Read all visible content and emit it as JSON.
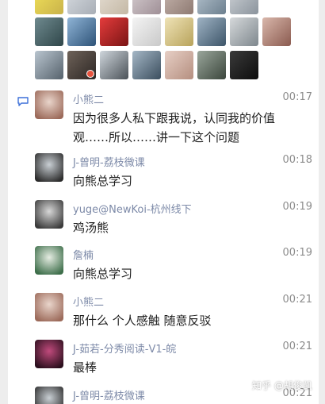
{
  "members_grid": {
    "avatars": [
      {
        "icon": "member-avatar",
        "colors": [
          "#f2e35a",
          "#c9b24a"
        ]
      },
      {
        "icon": "member-avatar",
        "colors": [
          "#d9dde2",
          "#a8aeb6"
        ]
      },
      {
        "icon": "member-avatar",
        "colors": [
          "#e6dfd5",
          "#c4b8a5"
        ]
      },
      {
        "icon": "member-avatar",
        "colors": [
          "#d8d0d3",
          "#9f8f96"
        ]
      },
      {
        "icon": "member-avatar",
        "colors": [
          "#c8b7b0",
          "#8e7a72"
        ]
      },
      {
        "icon": "member-avatar",
        "colors": [
          "#b9c7d2",
          "#6c7f8e"
        ]
      },
      {
        "icon": "member-avatar",
        "colors": [
          "#d0d4d8",
          "#8a939c"
        ]
      },
      {
        "icon": "member-avatar",
        "colors": [
          "#6f8a8f",
          "#2f4649"
        ]
      },
      {
        "icon": "member-avatar",
        "colors": [
          "#8fb4d6",
          "#2e5378"
        ]
      },
      {
        "icon": "member-avatar",
        "colors": [
          "#e53c3c",
          "#7a1414"
        ]
      },
      {
        "icon": "member-avatar",
        "colors": [
          "#f4f4f4",
          "#c9c9c9"
        ]
      },
      {
        "icon": "member-avatar",
        "colors": [
          "#efe3b7",
          "#b8a35b"
        ]
      },
      {
        "icon": "member-avatar",
        "colors": [
          "#9fb3c4",
          "#3d5569"
        ]
      },
      {
        "icon": "member-avatar",
        "colors": [
          "#d6d9db",
          "#7e878d"
        ]
      },
      {
        "icon": "member-avatar",
        "colors": [
          "#d9b7ab",
          "#8a5a4f"
        ]
      },
      {
        "icon": "member-avatar",
        "colors": [
          "#b9c5cf",
          "#56626c"
        ]
      },
      {
        "icon": "member-avatar",
        "colors": [
          "#6e6259",
          "#2d2724"
        ],
        "badge": true
      },
      {
        "icon": "member-avatar",
        "colors": [
          "#cfd6dc",
          "#4b5258"
        ]
      },
      {
        "icon": "member-avatar",
        "colors": [
          "#a5b7c6",
          "#3b4e5e"
        ]
      },
      {
        "icon": "member-avatar",
        "colors": [
          "#e7cfc5",
          "#b58f80"
        ]
      },
      {
        "icon": "member-avatar",
        "colors": [
          "#9aa69b",
          "#3b463c"
        ]
      },
      {
        "icon": "member-avatar",
        "colors": [
          "#3a3a3a",
          "#0d0d0d"
        ]
      }
    ]
  },
  "messages": [
    {
      "name": "小熊二",
      "time": "00:17",
      "text": "因为很多人私下跟我说，认同我的价值观……所以……讲一下这个问题",
      "avatar_colors": [
        "#e9d5cb",
        "#9c6a5a"
      ],
      "name_color": "#7d8aa8"
    },
    {
      "name": "J-曾明-荔枝微课",
      "time": "00:18",
      "text": "向熊总学习",
      "avatar_colors": [
        "#c9cfd4",
        "#2c2c2c"
      ],
      "name_color": "#7d8aa8"
    },
    {
      "name": "yuge@NewKoi-杭州线下",
      "time": "00:19",
      "text": "鸡汤熊",
      "avatar_colors": [
        "#d7d7d7",
        "#3a3a3a"
      ],
      "name_color": "#7d8aa8"
    },
    {
      "name": "詹楠",
      "time": "00:19",
      "text": "向熊总学习",
      "avatar_colors": [
        "#e5ece2",
        "#3d6e4a"
      ],
      "name_color": "#7d8aa8"
    },
    {
      "name": "小熊二",
      "time": "00:21",
      "text": "那什么 个人感触 随意反驳",
      "avatar_colors": [
        "#e9d5cb",
        "#9c6a5a"
      ],
      "name_color": "#7d8aa8"
    },
    {
      "name": "J-茹若-分秀阅读-V1-皖",
      "time": "00:21",
      "text": "最棒",
      "avatar_colors": [
        "#c04a7c",
        "#2b0f1d"
      ],
      "name_color": "#7d8aa8"
    },
    {
      "name": "J-曾明-荔枝微课",
      "time": "00:21",
      "text": "",
      "avatar_colors": [
        "#c9cfd4",
        "#2c2c2c"
      ],
      "name_color": "#7d8aa8"
    }
  ],
  "watermark": "知乎 @胡俊凯",
  "icons": {
    "side_chat": "chat-bubble-icon"
  }
}
